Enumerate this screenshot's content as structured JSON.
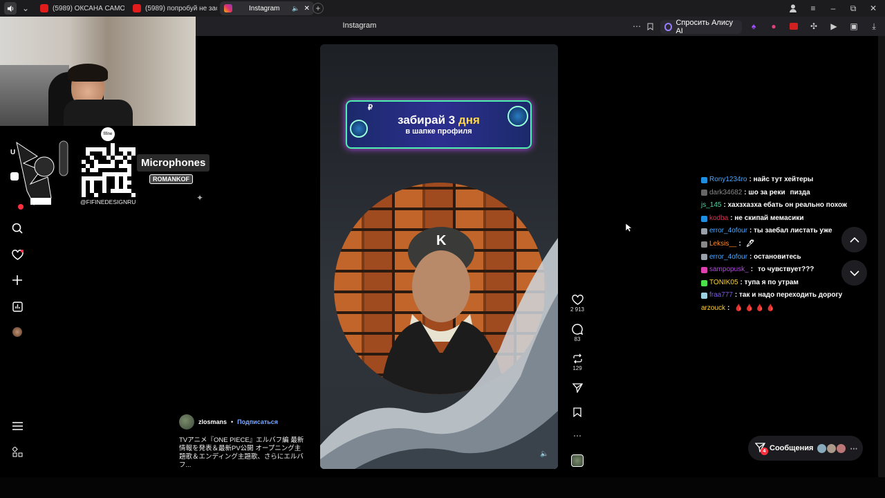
{
  "browser": {
    "tabs": [
      {
        "label": "(5989) ОКСАНА САМОЙЛ",
        "icon": "youtube-icon"
      },
      {
        "label": "(5989) попробуй не засм",
        "icon": "youtube-icon"
      },
      {
        "label": "Instagram",
        "icon": "instagram-icon",
        "active": true
      }
    ],
    "page_title": "Instagram",
    "alice_label": "Спросить Алису AI"
  },
  "overlay": {
    "handle": "@FIFINEDESIGNRU",
    "brand": "fifine",
    "microphones": "Microphones",
    "romankof": "ROMANKOF"
  },
  "post": {
    "banner_line1_prefix": "забирай 3 ",
    "banner_line1_highlight": "дня",
    "banner_line2": "в шапке профиля",
    "likes": "2 913",
    "comments": "83",
    "reposts": "129",
    "user": "zlosmans",
    "follow": "Подписаться",
    "caption": "TVアニメ『ONE PIECE』エルバフ編 最新情報を発表＆最新PV公開 オープニング主題歌＆エンディング主題歌、さらにエルバフ..."
  },
  "chat": [
    {
      "user": "Rony1234ro",
      "color": "#4aa8ff",
      "badge": "#1e8fe0",
      "text": ": найс тут хейтеры"
    },
    {
      "user": "dark34682",
      "color": "#8a8a8a",
      "badge": "#666666",
      "text": ": шо за реки",
      "extra": "пизда"
    },
    {
      "user": "js_145",
      "color": "#4ad6a0",
      "badge": "",
      "text": ": хахзхазха ебать он реально похож"
    },
    {
      "user": "kodba",
      "color": "#e03050",
      "badge": "#1e8fe0",
      "text": ": не скипай мемасики"
    },
    {
      "user": "error_4ofour",
      "color": "#4aa8ff",
      "badge": "#9aa0aa",
      "text": ": ты заебал листать уже"
    },
    {
      "user": "Leksis__",
      "color": "#ff8a2a",
      "badge": "#888888",
      "text": ":",
      "extra": "🖊"
    },
    {
      "user": "error_4ofour",
      "color": "#4aa8ff",
      "badge": "#9aa0aa",
      "text": ": остановитесь"
    },
    {
      "user": "sampopusk_",
      "color": "#b04ae0",
      "badge": "#e040b0",
      "text": ":",
      "extra": "то чувствует???"
    },
    {
      "user": "TONIK05",
      "color": "#ffd23a",
      "badge": "#4ae04a",
      "text": ": тупа я по утрам"
    },
    {
      "user": "fraa777",
      "color": "#7a5ae0",
      "badge": "#9ad0e0",
      "text": ": так и надо переходить дорогу"
    },
    {
      "user": "arzouck",
      "color": "#ffd23a",
      "badge": "",
      "text": ":",
      "extra": "🩸 🩸 🩸 🩸"
    }
  ],
  "messages": {
    "label": "Сообщения",
    "count": "4"
  }
}
